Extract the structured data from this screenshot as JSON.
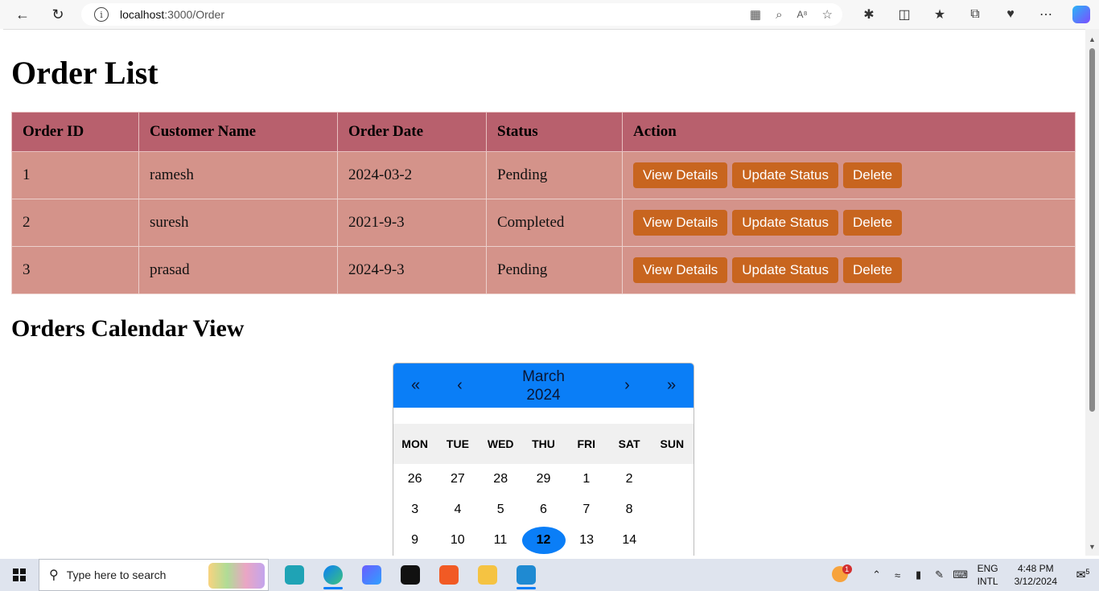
{
  "browser": {
    "url_host": "localhost",
    "url_path": ":3000/Order"
  },
  "page": {
    "title": "Order List",
    "table": {
      "headers": [
        "Order ID",
        "Customer Name",
        "Order Date",
        "Status",
        "Action"
      ],
      "rows": [
        {
          "id": "1",
          "customer": "ramesh",
          "date": "2024-03-2",
          "status": "Pending"
        },
        {
          "id": "2",
          "customer": "suresh",
          "date": "2021-9-3",
          "status": "Completed"
        },
        {
          "id": "3",
          "customer": "prasad",
          "date": "2024-9-3",
          "status": "Pending"
        }
      ],
      "actions": {
        "view": "View Details",
        "update": "Update Status",
        "delete": "Delete"
      }
    },
    "calendar_title": "Orders Calendar View",
    "calendar": {
      "nav_prev2": "«",
      "nav_prev": "‹",
      "month": "March",
      "year": "2024",
      "nav_next": "›",
      "nav_next2": "»",
      "weekdays": [
        "MON",
        "TUE",
        "WED",
        "THU",
        "FRI",
        "SAT",
        "SUN"
      ],
      "weeks": [
        [
          "26",
          "27",
          "28",
          "29",
          "1",
          "2",
          ""
        ],
        [
          "3",
          "4",
          "5",
          "6",
          "7",
          "8",
          ""
        ],
        [
          "9",
          "10",
          "11",
          "12",
          "13",
          "14",
          ""
        ]
      ],
      "selected_day": "12",
      "accent_color": "#0a7ef7"
    }
  },
  "taskbar": {
    "search_placeholder": "Type here to search",
    "lang_top": "ENG",
    "lang_bottom": "INTL",
    "time": "4:48 PM",
    "date": "3/12/2024",
    "notification_count": "5",
    "widget_badge": "1"
  }
}
